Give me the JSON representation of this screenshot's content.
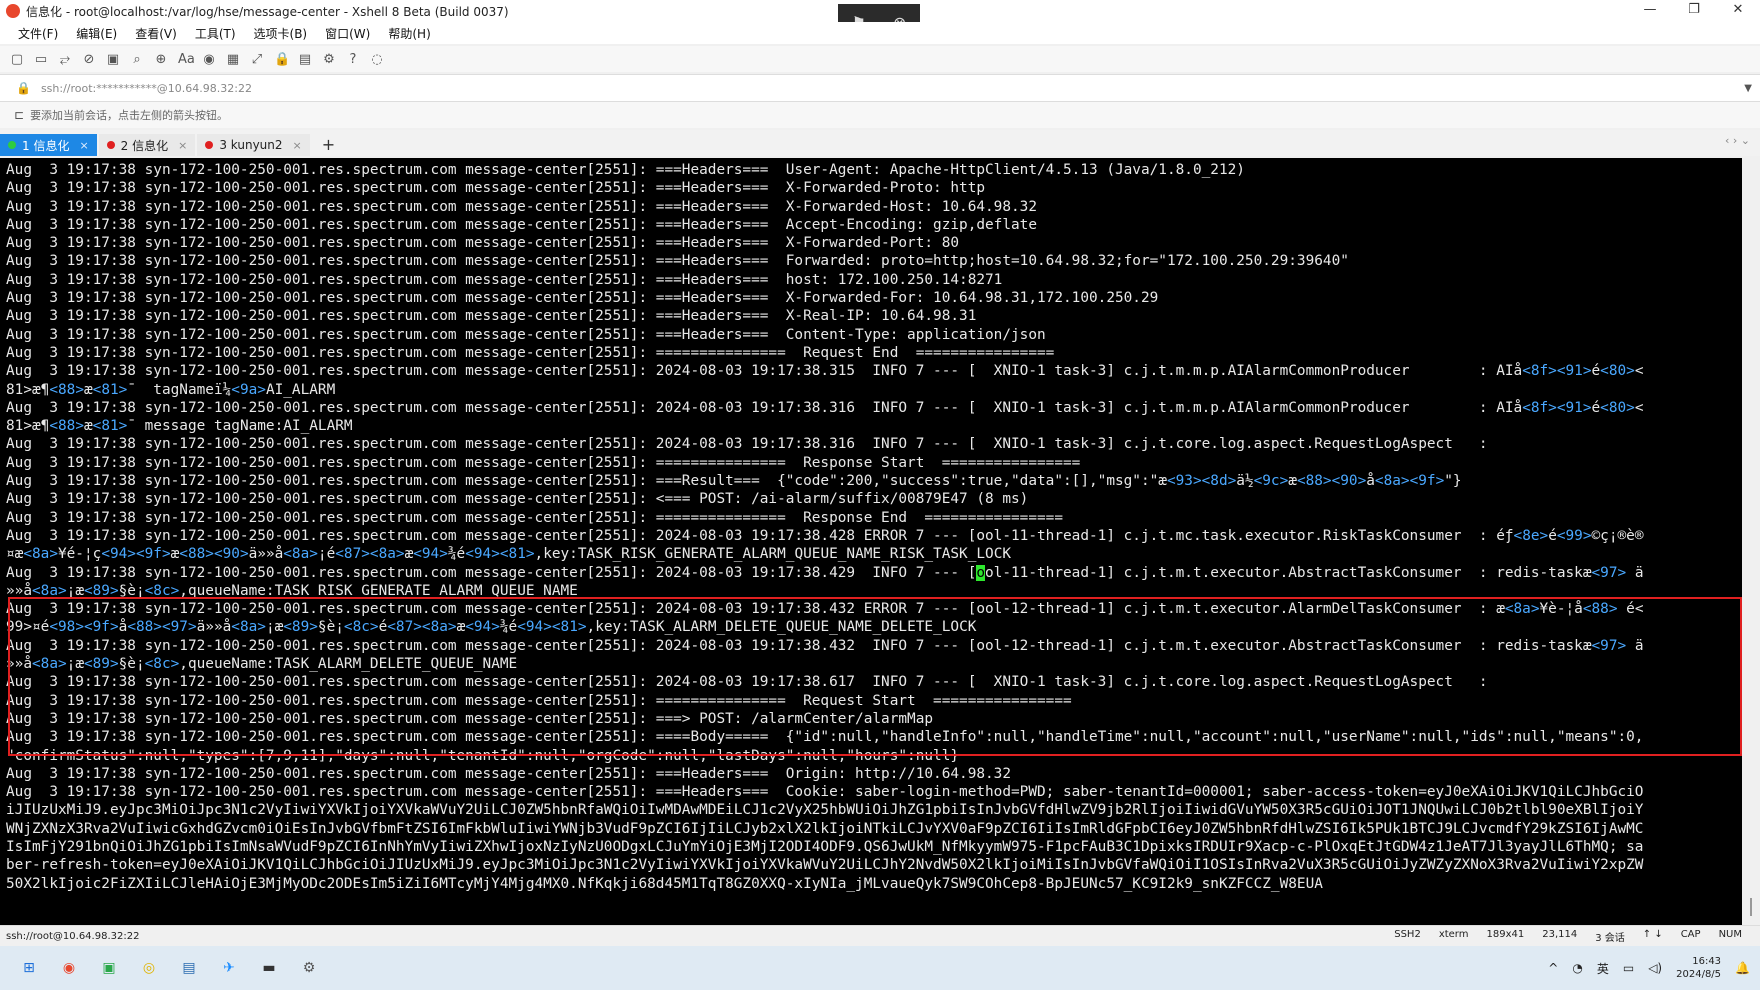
{
  "window": {
    "title": "信息化 - root@localhost:/var/log/hse/message-center - Xshell 8 Beta (Build 0037)",
    "controls": [
      "—",
      "❐",
      "✕"
    ]
  },
  "float_bar": {
    "icons": [
      "flag-icon",
      "close-circle-icon"
    ],
    "glyphs": [
      "⚑",
      "⊗"
    ]
  },
  "menu": [
    "文件(F)",
    "编辑(E)",
    "查看(V)",
    "工具(T)",
    "选项卡(B)",
    "窗口(W)",
    "帮助(H)"
  ],
  "toolbar": {
    "icons": [
      "new-session-icon",
      "open-folder-icon",
      "reconnect-icon",
      "disconnect-icon",
      "new-tab-icon",
      "find-icon",
      "globe-icon",
      "font-icon",
      "xftp-icon",
      "xmanager-icon",
      "fullscreen-icon",
      "lock-icon",
      "compose-icon",
      "settings-icon",
      "help-icon",
      "chat-icon"
    ],
    "glyphs": [
      "▢",
      "▭",
      "⥂",
      "⊘",
      "▣",
      "⌕",
      "⊕",
      "Aa",
      "◉",
      "▦",
      "⤢",
      "🔒",
      "▤",
      "⚙",
      "?",
      "◌"
    ]
  },
  "address": {
    "url": "ssh://root:***********@10.64.98.32:22"
  },
  "hint": {
    "text": "要添加当前会话，点击左侧的箭头按钮。"
  },
  "tabs": [
    {
      "label": "1 信息化",
      "dot": "#2ecc40",
      "active": true
    },
    {
      "label": "2 信息化",
      "dot": "#e02020",
      "active": false
    },
    {
      "label": "3 kunyun2",
      "dot": "#e02020",
      "active": false
    }
  ],
  "tab_close": "×",
  "new_tab": "+",
  "tab_nav": "‹ ›  ⌄",
  "terminal": {
    "lines": [
      "Aug  3 19:17:38 syn-172-100-250-001.res.spectrum.com message-center[2551]: ===Headers===  User-Agent: Apache-HttpClient/4.5.13 (Java/1.8.0_212)",
      "Aug  3 19:17:38 syn-172-100-250-001.res.spectrum.com message-center[2551]: ===Headers===  X-Forwarded-Proto: http",
      "Aug  3 19:17:38 syn-172-100-250-001.res.spectrum.com message-center[2551]: ===Headers===  X-Forwarded-Host: 10.64.98.32",
      "Aug  3 19:17:38 syn-172-100-250-001.res.spectrum.com message-center[2551]: ===Headers===  Accept-Encoding: gzip,deflate",
      "Aug  3 19:17:38 syn-172-100-250-001.res.spectrum.com message-center[2551]: ===Headers===  X-Forwarded-Port: 80",
      "Aug  3 19:17:38 syn-172-100-250-001.res.spectrum.com message-center[2551]: ===Headers===  Forwarded: proto=http;host=10.64.98.32;for=\"172.100.250.29:39640\"",
      "Aug  3 19:17:38 syn-172-100-250-001.res.spectrum.com message-center[2551]: ===Headers===  host: 172.100.250.14:8271",
      "Aug  3 19:17:38 syn-172-100-250-001.res.spectrum.com message-center[2551]: ===Headers===  X-Forwarded-For: 10.64.98.31,172.100.250.29",
      "Aug  3 19:17:38 syn-172-100-250-001.res.spectrum.com message-center[2551]: ===Headers===  X-Real-IP: 10.64.98.31",
      "Aug  3 19:17:38 syn-172-100-250-001.res.spectrum.com message-center[2551]: ===Headers===  Content-Type: application/json",
      "Aug  3 19:17:38 syn-172-100-250-001.res.spectrum.com message-center[2551]: ===============  Request End  ================",
      "Aug  3 19:17:38 syn-172-100-250-001.res.spectrum.com message-center[2551]: 2024-08-03 19:17:38.315  INFO 7 --- [  XNIO-1 task-3] c.j.t.m.m.p.AIAlarmCommonProducer        : AIå<8f><91>é<80><",
      "81>æ¶<88>æ<81>¯  tagNameï¼<9a>AI_ALARM",
      "Aug  3 19:17:38 syn-172-100-250-001.res.spectrum.com message-center[2551]: 2024-08-03 19:17:38.316  INFO 7 --- [  XNIO-1 task-3] c.j.t.m.m.p.AIAlarmCommonProducer        : AIå<8f><91>é<80><",
      "81>æ¶<88>æ<81>¯ message tagName:AI_ALARM",
      "Aug  3 19:17:38 syn-172-100-250-001.res.spectrum.com message-center[2551]: 2024-08-03 19:17:38.316  INFO 7 --- [  XNIO-1 task-3] c.j.t.core.log.aspect.RequestLogAspect   :",
      "Aug  3 19:17:38 syn-172-100-250-001.res.spectrum.com message-center[2551]: ===============  Response Start  ================",
      "Aug  3 19:17:38 syn-172-100-250-001.res.spectrum.com message-center[2551]: ===Result===  {\"code\":200,\"success\":true,\"data\":[],\"msg\":\"æ<93><8d>ä½<9c>æ<88><90>å<8a><9f>\"}",
      "Aug  3 19:17:38 syn-172-100-250-001.res.spectrum.com message-center[2551]: <=== POST: /ai-alarm/suffix/00879E47 (8 ms)",
      "Aug  3 19:17:38 syn-172-100-250-001.res.spectrum.com message-center[2551]: ===============  Response End  ================",
      "Aug  3 19:17:38 syn-172-100-250-001.res.spectrum.com message-center[2551]: 2024-08-03 19:17:38.428 ERROR 7 --- [ool-11-thread-1] c.j.t.mc.task.executor.RiskTaskConsumer  : éƒ<8e>é<99>©ç¡®è®",
      "¤æ<8a>¥é-¦ç<94><9f>æ<88><90>ä»»å<8a>¡é<87><8a>æ<94>¾é<94><81>,key:TASK_RISK_GENERATE_ALARM_QUEUE_NAME_RISK_TASK_LOCK",
      "Aug  3 19:17:38 syn-172-100-250-001.res.spectrum.com message-center[2551]: 2024-08-03 19:17:38.429  INFO 7 --- [ool-11-thread-1] c.j.t.m.t.executor.AbstractTaskConsumer  : redis-taskæ<97> ä",
      "»»å<8a>¡æ<89>§è¡<8c>,queueName:TASK_RISK_GENERATE_ALARM_QUEUE_NAME",
      "Aug  3 19:17:38 syn-172-100-250-001.res.spectrum.com message-center[2551]: 2024-08-03 19:17:38.432 ERROR 7 --- [ool-12-thread-1] c.j.t.m.t.executor.AlarmDelTaskConsumer  : æ<8a>¥è-¦å<88> é<",
      "99>¤é<98><9f>å<88><97>ä»»å<8a>¡æ<89>§è¡<8c>é<87><8a>æ<94>¾é<94><81>,key:TASK_ALARM_DELETE_QUEUE_NAME_DELETE_LOCK",
      "Aug  3 19:17:38 syn-172-100-250-001.res.spectrum.com message-center[2551]: 2024-08-03 19:17:38.432  INFO 7 --- [ool-12-thread-1] c.j.t.m.t.executor.AbstractTaskConsumer  : redis-taskæ<97> ä",
      "»»å<8a>¡æ<89>§è¡<8c>,queueName:TASK_ALARM_DELETE_QUEUE_NAME",
      "Aug  3 19:17:38 syn-172-100-250-001.res.spectrum.com message-center[2551]: 2024-08-03 19:17:38.617  INFO 7 --- [  XNIO-1 task-3] c.j.t.core.log.aspect.RequestLogAspect   :",
      "Aug  3 19:17:38 syn-172-100-250-001.res.spectrum.com message-center[2551]: ===============  Request Start  ================",
      "Aug  3 19:17:38 syn-172-100-250-001.res.spectrum.com message-center[2551]: ===> POST: /alarmCenter/alarmMap",
      "Aug  3 19:17:38 syn-172-100-250-001.res.spectrum.com message-center[2551]: ====Body=====  {\"id\":null,\"handleInfo\":null,\"handleTime\":null,\"account\":null,\"userName\":null,\"ids\":null,\"means\":0,",
      "\"confirmStatus\":null,\"types\":[7,9,11],\"days\":null,\"tenantId\":null,\"orgCode\":null,\"lastDays\":null,\"hours\":null}",
      "Aug  3 19:17:38 syn-172-100-250-001.res.spectrum.com message-center[2551]: ===Headers===  Origin: http://10.64.98.32",
      "Aug  3 19:17:38 syn-172-100-250-001.res.spectrum.com message-center[2551]: ===Headers===  Cookie: saber-login-method=PWD; saber-tenantId=000001; saber-access-token=eyJ0eXAiOiJKV1QiLCJhbGciO",
      "iJIUzUxMiJ9.eyJpc3MiOiJpc3N1c2VyIiwiYXVkIjoiYXVkaWVuY2UiLCJ0ZW5hbnRfaWQiOiIwMDAwMDEiLCJ1c2VyX25hbWUiOiJhZG1pbiIsInJvbGVfdHlwZV9jb2RlIjoiIiwidGVuYW50X3R5cGUiOiJOT1JNQUwiLCJ0b2tlbl90eXBlIjoiY",
      "WNjZXNzX3Rva2VuIiwicGxhdGZvcm0iOiEsInJvbGVfbmFtZSI6ImFkbWluIiwiYWNjb3VudF9pZCI6IjIiLCJyb2xlX2lkIjoiNTkiLCJvYXV0aF9pZCI6IiIsImRldGFpbCI6eyJ0ZW5hbnRfdHlwZSI6Ik5PUk1BTCJ9LCJvcmdfY29kZSI6IjAwMC",
      "IsImFjY291bnQiOiJhZG1pbiIsImNsaWVudF9pZCI6InNhYmVyIiwiZXhwIjoxNzIyNzU0ODgxLCJuYmYiOjE3MjI2ODI4ODF9.QS6JwUkM_NfMkyymW975-F1pcFAuB3C1DpixksIRDUIr9Xacp-c-PlOxqEtJtGDW4z1JeAT7Jl3yayJlL6ThMQ; sa",
      "ber-refresh-token=eyJ0eXAiOiJKV1QiLCJhbGciOiJIUzUxMiJ9.eyJpc3MiOiJpc3N1c2VyIiwiYXVkIjoiYXVkaWVuY2UiLCJhY2NvdW50X2lkIjoiMiIsInJvbGVfaWQiOiI1OSIsInRva2VuX3R5cGUiOiJyZWZyZXNoX3Rva2VuIiwiY2xpZW",
      "50X2lkIjoic2FiZXIiLCJleHAiOjE3MjMyODc2ODEsIm5iZiI6MTcyMjY4Mjg4MX0.NfKqkji68d45M1TqT8GZ0XXQ-xIyNIa_jMLvaueQyk7SW9COhCep8-BpJEUNc57_KC9I2k9_snKZFCCZ_W8EUA"
    ],
    "cursor": {
      "line": 22,
      "char": "o"
    },
    "highlight_color": "#e02020",
    "hex_escape_color": "#4aa8ff"
  },
  "status": {
    "left": "ssh://root@10.64.98.32:22",
    "protocol": "SSH2",
    "term": "xterm",
    "size": "189x41",
    "position": "23,114",
    "sessions": "3 会话",
    "arrows": "↑ ↓",
    "cap": "CAP",
    "num": "NUM"
  },
  "taskbar": {
    "apps": [
      {
        "icon": "windows-start-icon",
        "glyph": "⊞",
        "color": "#1e6fd9"
      },
      {
        "icon": "xshell-icon",
        "glyph": "◉",
        "color": "#e8472d"
      },
      {
        "icon": "wechat-work-icon",
        "glyph": "▣",
        "color": "#2aa84a"
      },
      {
        "icon": "chrome-icon",
        "glyph": "◎",
        "color": "#e0b400"
      },
      {
        "icon": "notepad-icon",
        "glyph": "▤",
        "color": "#2b6cb0"
      },
      {
        "icon": "dingtalk-icon",
        "glyph": "✈",
        "color": "#1a8cff"
      },
      {
        "icon": "terminal-icon",
        "glyph": "▬",
        "color": "#333333"
      },
      {
        "icon": "settings-icon",
        "glyph": "⚙",
        "color": "#555555"
      }
    ],
    "tray": {
      "chevron": "^",
      "network": "◔",
      "ime": "英",
      "battery": "▭",
      "volume": "◁)",
      "time": "16:43",
      "date": "2024/8/5",
      "bell": "🔔"
    }
  }
}
